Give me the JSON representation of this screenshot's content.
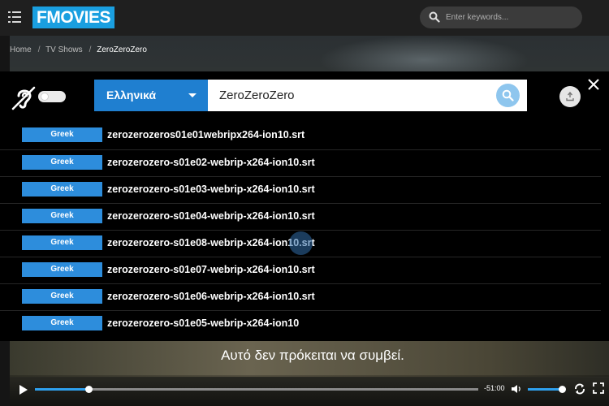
{
  "header": {
    "logo_text": "FMOVIES",
    "search_placeholder": "Enter keywords..."
  },
  "breadcrumb": {
    "items": [
      "Home",
      "TV Shows",
      "ZeroZeroZero"
    ]
  },
  "subtitle_panel": {
    "language": "Ελληνικά",
    "query": "ZeroZeroZero",
    "cc_toggle": "off",
    "results": [
      {
        "lang": "Greek",
        "file": "zerozerozeros01e01webripx264-ion10.srt"
      },
      {
        "lang": "Greek",
        "file": "zerozerozero-s01e02-webrip-x264-ion10.srt"
      },
      {
        "lang": "Greek",
        "file": "zerozerozero-s01e03-webrip-x264-ion10.srt"
      },
      {
        "lang": "Greek",
        "file": "zerozerozero-s01e04-webrip-x264-ion10.srt"
      },
      {
        "lang": "Greek",
        "file": "zerozerozero-s01e08-webrip-x264-ion10.srt"
      },
      {
        "lang": "Greek",
        "file": "zerozerozero-s01e07-webrip-x264-ion10.srt"
      },
      {
        "lang": "Greek",
        "file": "zerozerozero-s01e06-webrip-x264-ion10.srt"
      },
      {
        "lang": "Greek",
        "file": "zerozerozero-s01e05-webrip-x264-ion10"
      }
    ]
  },
  "player": {
    "caption": "Αυτό δεν πρόκειται να συμβεί.",
    "time_remaining": "-51:00",
    "progress": 0.12,
    "volume": 0.95
  },
  "colors": {
    "accent": "#2d8ddc",
    "logo_bg": "#1a9fe0"
  }
}
